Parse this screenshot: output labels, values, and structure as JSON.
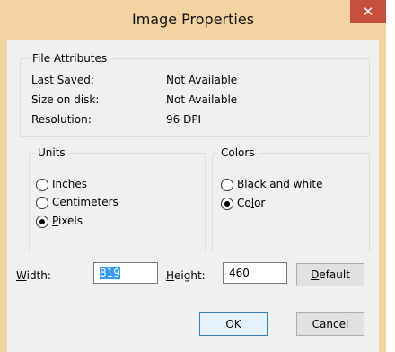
{
  "window": {
    "title": "Image Properties",
    "close_glyph": "✕"
  },
  "file_attributes": {
    "legend": "File Attributes",
    "rows": [
      {
        "label": "Last Saved:",
        "value": "Not Available"
      },
      {
        "label": "Size on disk:",
        "value": "Not Available"
      },
      {
        "label": "Resolution:",
        "value": "96 DPI"
      }
    ]
  },
  "units": {
    "legend": "Units",
    "options": [
      {
        "pre": "",
        "u": "I",
        "post": "nches",
        "selected": false
      },
      {
        "pre": "Centi",
        "u": "m",
        "post": "eters",
        "selected": false
      },
      {
        "pre": "",
        "u": "P",
        "post": "ixels",
        "selected": true
      }
    ]
  },
  "colors": {
    "legend": "Colors",
    "options": [
      {
        "pre": "",
        "u": "B",
        "post": "lack and white",
        "selected": false
      },
      {
        "pre": "Co",
        "u": "l",
        "post": "or",
        "selected": true
      }
    ]
  },
  "size": {
    "width_label_u": "W",
    "width_label_rest": "idth:",
    "width_value": "819",
    "height_label_u": "H",
    "height_label_rest": "eight:",
    "height_value": "460"
  },
  "buttons": {
    "default_u": "D",
    "default_rest": "efault",
    "ok": "OK",
    "cancel": "Cancel"
  }
}
